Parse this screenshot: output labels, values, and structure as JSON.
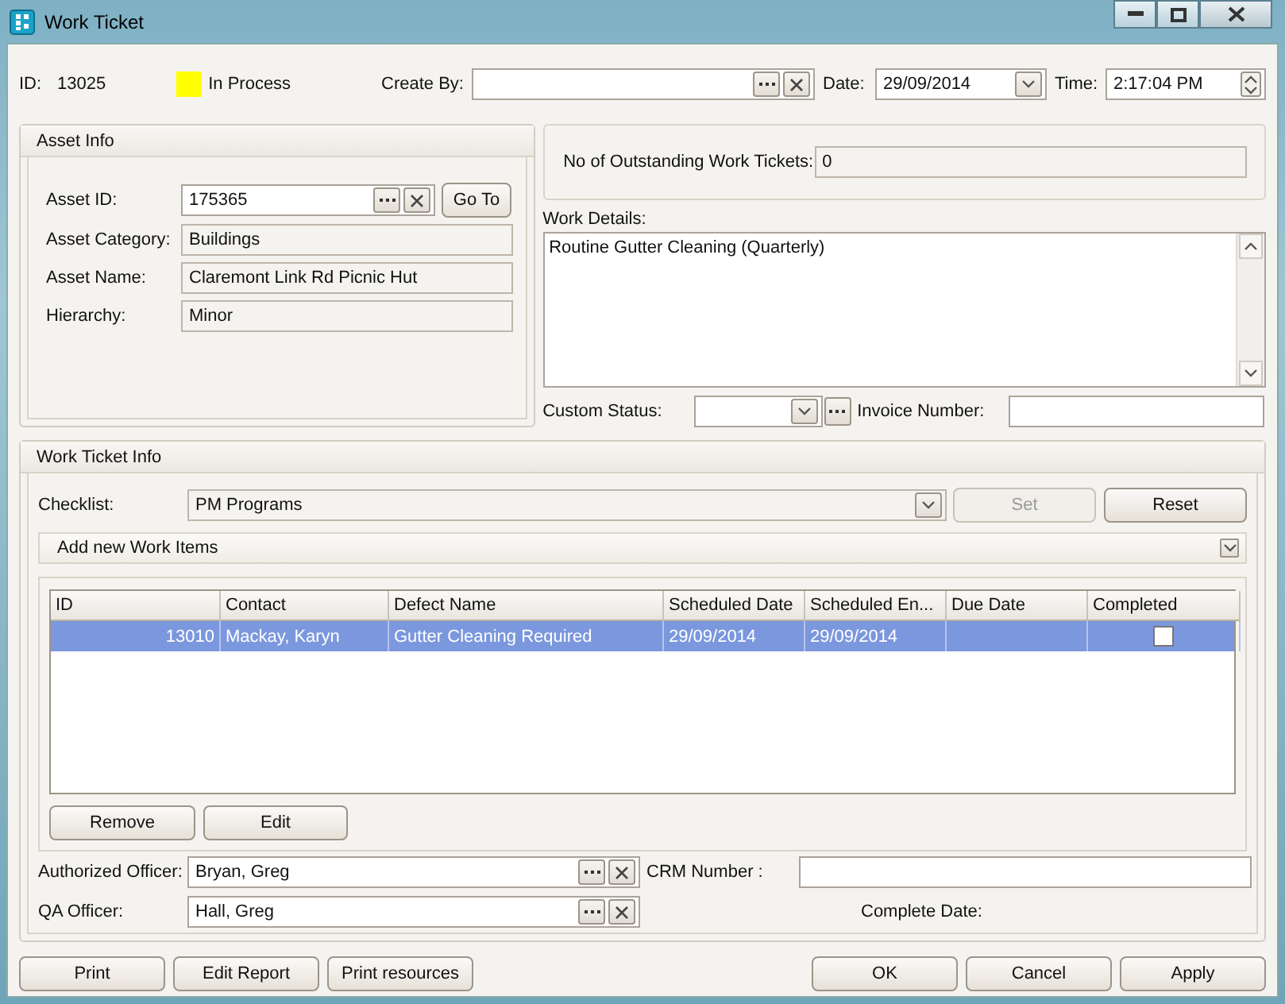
{
  "window": {
    "title": "Work Ticket"
  },
  "header": {
    "id_label": "ID:",
    "id": "13025",
    "status": {
      "label": "In Process",
      "color": "#ffff00"
    },
    "create_by": {
      "label": "Create By:"
    },
    "date": {
      "label": "Date:",
      "value": "29/09/2014"
    },
    "time": {
      "label": "Time:",
      "value": "2:17:04 PM"
    }
  },
  "asset_info": {
    "title": "Asset Info",
    "asset_id": {
      "label": "Asset ID:",
      "value": "175365"
    },
    "go_to": "Go To",
    "fields": [
      {
        "label": "Asset Category:",
        "value": "Buildings"
      },
      {
        "label": "Asset Name:",
        "value": "Claremont Link Rd Picnic Hut"
      },
      {
        "label": "Hierarchy:",
        "value": "Minor"
      }
    ]
  },
  "outstanding": {
    "label": "No of Outstanding Work Tickets:",
    "value": "0"
  },
  "work_details": {
    "label": "Work Details:",
    "value": "Routine Gutter Cleaning (Quarterly)"
  },
  "custom_status": {
    "label": "Custom Status:"
  },
  "invoice_number": {
    "label": "Invoice Number:"
  },
  "work_ticket_info": {
    "title": "Work Ticket Info",
    "checklist": {
      "label": "Checklist:",
      "value": "PM Programs"
    },
    "set_button": {
      "label": "Set",
      "disabled": true
    },
    "reset_button": "Reset",
    "add_items": "Add new Work Items",
    "table": {
      "columns": [
        "ID",
        "Contact",
        "Defect Name",
        "Scheduled Date",
        "Scheduled En...",
        "Due Date",
        "Completed"
      ],
      "rows": [
        {
          "id": "13010",
          "contact": "Mackay, Karyn",
          "defect_name": "Gutter Cleaning Required",
          "scheduled_date": "29/09/2014",
          "scheduled_end": "29/09/2014",
          "completed": false,
          "selected": true
        }
      ]
    },
    "remove_button": "Remove",
    "edit_button": "Edit",
    "authorized_officer": {
      "label": "Authorized Officer:",
      "value": "Bryan, Greg"
    },
    "qa_officer": {
      "label": "QA Officer:",
      "value": "Hall, Greg"
    },
    "crm_number": {
      "label": "CRM Number :"
    },
    "complete_date": {
      "label": "Complete Date:"
    }
  },
  "left_buttons": [
    "Print",
    "Edit Report",
    "Print resources"
  ],
  "right_buttons": [
    "OK",
    "Cancel",
    "Apply"
  ]
}
